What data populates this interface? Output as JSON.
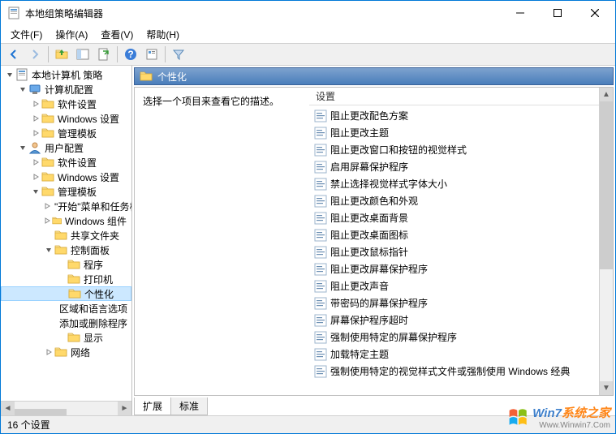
{
  "window": {
    "title": "本地组策略编辑器",
    "menus": [
      "文件(F)",
      "操作(A)",
      "查看(V)",
      "帮助(H)"
    ]
  },
  "tree": {
    "root": "本地计算机 策略",
    "nodes": [
      {
        "depth": 0,
        "tw": "v",
        "icon": "root",
        "label": "本地计算机 策略"
      },
      {
        "depth": 1,
        "tw": "v",
        "icon": "config",
        "label": "计算机配置"
      },
      {
        "depth": 2,
        "tw": ">",
        "icon": "folder",
        "label": "软件设置"
      },
      {
        "depth": 2,
        "tw": ">",
        "icon": "folder",
        "label": "Windows 设置"
      },
      {
        "depth": 2,
        "tw": ">",
        "icon": "folder",
        "label": "管理模板"
      },
      {
        "depth": 1,
        "tw": "v",
        "icon": "user",
        "label": "用户配置"
      },
      {
        "depth": 2,
        "tw": ">",
        "icon": "folder",
        "label": "软件设置"
      },
      {
        "depth": 2,
        "tw": ">",
        "icon": "folder",
        "label": "Windows 设置"
      },
      {
        "depth": 2,
        "tw": "v",
        "icon": "folder",
        "label": "管理模板"
      },
      {
        "depth": 3,
        "tw": ">",
        "icon": "folder",
        "label": "\"开始\"菜单和任务栏"
      },
      {
        "depth": 3,
        "tw": ">",
        "icon": "folder",
        "label": "Windows 组件"
      },
      {
        "depth": 3,
        "tw": "",
        "icon": "folder",
        "label": "共享文件夹"
      },
      {
        "depth": 3,
        "tw": "v",
        "icon": "folder",
        "label": "控制面板"
      },
      {
        "depth": 4,
        "tw": "",
        "icon": "folder",
        "label": "程序"
      },
      {
        "depth": 4,
        "tw": "",
        "icon": "folder",
        "label": "打印机"
      },
      {
        "depth": 4,
        "tw": "",
        "icon": "folder",
        "label": "个性化",
        "selected": true
      },
      {
        "depth": 4,
        "tw": "",
        "icon": "folder",
        "label": "区域和语言选项"
      },
      {
        "depth": 4,
        "tw": "",
        "icon": "folder",
        "label": "添加或删除程序"
      },
      {
        "depth": 4,
        "tw": "",
        "icon": "folder",
        "label": "显示"
      },
      {
        "depth": 3,
        "tw": ">",
        "icon": "folder",
        "label": "网络"
      }
    ]
  },
  "right": {
    "header": "个性化",
    "description": "选择一个项目来查看它的描述。",
    "column": "设置",
    "items": [
      "阻止更改配色方案",
      "阻止更改主题",
      "阻止更改窗口和按钮的视觉样式",
      "启用屏幕保护程序",
      "禁止选择视觉样式字体大小",
      "阻止更改颜色和外观",
      "阻止更改桌面背景",
      "阻止更改桌面图标",
      "阻止更改鼠标指针",
      "阻止更改屏幕保护程序",
      "阻止更改声音",
      "带密码的屏幕保护程序",
      "屏幕保护程序超时",
      "强制使用特定的屏幕保护程序",
      "加载特定主题",
      "强制使用特定的视觉样式文件或强制使用 Windows 经典"
    ],
    "tabs": [
      "扩展",
      "标准"
    ],
    "active_tab": 0
  },
  "status": "16 个设置",
  "watermark": {
    "line1a": "Win7",
    "line1b": "系统之家",
    "line2": "Www.Winwin7.Com"
  }
}
